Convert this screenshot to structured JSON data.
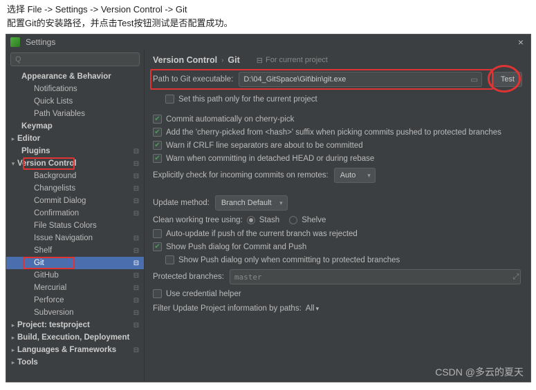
{
  "instructions": {
    "line1": "选择 File -> Settings -> Version Control -> Git",
    "line2": "配置Git的安装路径，并点击Test按钮测试是否配置成功。"
  },
  "window": {
    "title": "Settings",
    "close": "×"
  },
  "search_placeholder": "",
  "sidebar": {
    "appearance_behavior": "Appearance & Behavior",
    "notifications": "Notifications",
    "quick_lists": "Quick Lists",
    "path_variables": "Path Variables",
    "keymap": "Keymap",
    "editor": "Editor",
    "plugins": "Plugins",
    "version_control": "Version Control",
    "background": "Background",
    "changelists": "Changelists",
    "commit_dialog": "Commit Dialog",
    "confirmation": "Confirmation",
    "file_status_colors": "File Status Colors",
    "issue_navigation": "Issue Navigation",
    "shelf": "Shelf",
    "git": "Git",
    "github": "GitHub",
    "mercurial": "Mercurial",
    "perforce": "Perforce",
    "subversion": "Subversion",
    "project": "Project: testproject",
    "build": "Build, Execution, Deployment",
    "languages": "Languages & Frameworks",
    "tools": "Tools"
  },
  "breadcrumb": {
    "parent": "Version Control",
    "current": "Git",
    "scope": "For current project"
  },
  "path": {
    "label": "Path to Git executable:",
    "value": "D:\\04_GitSpace\\Git\\bin\\git.exe",
    "test": "Test"
  },
  "checks": {
    "set_path_only": "Set this path only for the current project",
    "commit_auto": "Commit automatically on cherry-pick",
    "cherry_suffix": "Add the 'cherry-picked from <hash>' suffix when picking commits pushed to protected branches",
    "warn_crlf": "Warn if CRLF line separators are about to be committed",
    "warn_detached": "Warn when committing in detached HEAD or during rebase",
    "auto_update_rejected": "Auto-update if push of the current branch was rejected",
    "show_push_dialog": "Show Push dialog for Commit and Push",
    "show_push_protected": "Show Push dialog only when committing to protected branches",
    "use_credential": "Use credential helper"
  },
  "fields": {
    "explicit_check": "Explicitly check for incoming commits on remotes:",
    "explicit_value": "Auto",
    "update_method": "Update method:",
    "update_value": "Branch Default",
    "clean_tree": "Clean working tree using:",
    "stash": "Stash",
    "shelve": "Shelve",
    "protected": "Protected branches:",
    "protected_value": "master",
    "filter_label": "Filter Update Project information by paths:",
    "filter_value": "All"
  },
  "watermark": "CSDN @多云的夏天"
}
